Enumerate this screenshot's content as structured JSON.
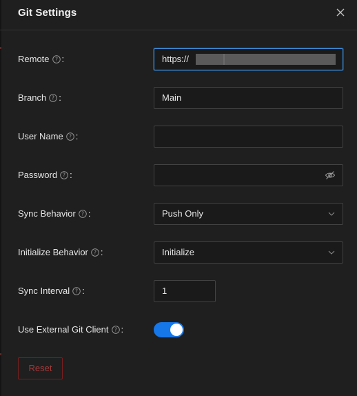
{
  "dialog": {
    "title": "Git Settings",
    "close_icon": "close-icon"
  },
  "fields": {
    "remote": {
      "label": "Remote",
      "value": "https://"
    },
    "branch": {
      "label": "Branch",
      "value": "Main"
    },
    "user_name": {
      "label": "User Name",
      "value": ""
    },
    "password": {
      "label": "Password",
      "value": "",
      "icon": "eye-invisible-icon"
    },
    "sync_behavior": {
      "label": "Sync Behavior",
      "selected": "Push Only"
    },
    "initialize_behavior": {
      "label": "Initialize Behavior",
      "selected": "Initialize"
    },
    "sync_interval": {
      "label": "Sync Interval",
      "value": "1"
    },
    "use_external_git_client": {
      "label": "Use External Git Client",
      "enabled": true
    }
  },
  "colon": ":",
  "actions": {
    "reset_label": "Reset"
  },
  "colors": {
    "background": "#1f1f1f",
    "accent": "#1677e8",
    "focus_border": "#3b8fe0",
    "danger": "#a33a3a"
  }
}
